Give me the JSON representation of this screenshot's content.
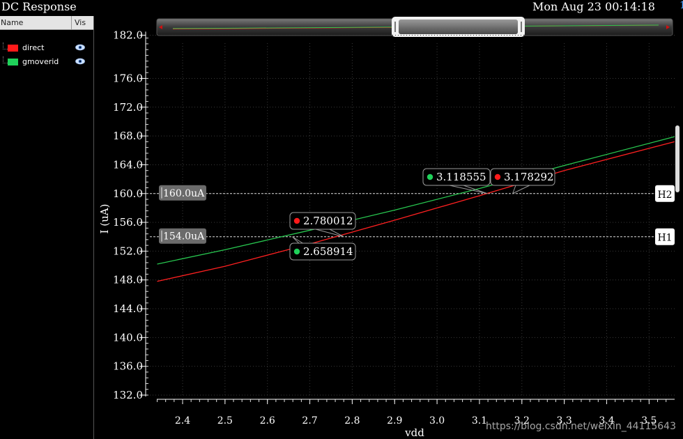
{
  "window": {
    "title": "DC Response",
    "datetime": "Mon Aug 23 00:14:18",
    "trunc_glyph": "1"
  },
  "legend": {
    "header_name": "Name",
    "header_vis": "Vis",
    "items": [
      {
        "label": "direct",
        "color": "#ff1a1a"
      },
      {
        "label": "gmoverid",
        "color": "#1fd15a"
      }
    ]
  },
  "chart_data": {
    "type": "line",
    "xlabel": "vdd",
    "ylabel": "I (uA)",
    "xlim": [
      2.34,
      3.56
    ],
    "ylim": [
      132.0,
      182.0
    ],
    "x_ticks": [
      "2.4",
      "2.5",
      "2.6",
      "2.7",
      "2.8",
      "2.9",
      "3.0",
      "3.1",
      "3.2",
      "3.3",
      "3.4",
      "3.5"
    ],
    "y_ticks": [
      "132.0",
      "136.0",
      "140.0",
      "144.0",
      "148.0",
      "152.0",
      "156.0",
      "160.0",
      "164.0",
      "168.0",
      "172.0",
      "176.0",
      "182.0"
    ],
    "grid": true,
    "series": [
      {
        "name": "direct",
        "color": "#ff2020",
        "x": [
          2.34,
          2.5,
          2.7,
          2.9,
          3.1,
          3.3,
          3.56
        ],
        "y": [
          147.8,
          149.9,
          153.0,
          156.3,
          159.7,
          163.2,
          167.2
        ]
      },
      {
        "name": "gmoverid",
        "color": "#28c850",
        "x": [
          2.34,
          2.5,
          2.7,
          2.9,
          3.1,
          3.3,
          3.56
        ],
        "y": [
          150.2,
          152.2,
          154.9,
          157.7,
          160.7,
          163.9,
          167.9
        ]
      }
    ],
    "h_markers": [
      {
        "label": "H1",
        "value": 154.0,
        "tag": "154.0uA"
      },
      {
        "label": "H2",
        "value": 160.0,
        "tag": "160.0uA"
      }
    ],
    "intercepts": [
      {
        "series": "direct",
        "x": 2.780012,
        "y": 154.0,
        "text": "2.780012",
        "color": "#ff1a1a"
      },
      {
        "series": "gmoverid",
        "x": 2.658914,
        "y": 154.0,
        "text": "2.658914",
        "color": "#1fd15a"
      },
      {
        "series": "gmoverid",
        "x": 3.118555,
        "y": 160.0,
        "text": "3.118555",
        "color": "#1fd15a"
      },
      {
        "series": "direct",
        "x": 3.178292,
        "y": 160.0,
        "text": "3.178292",
        "color": "#ff1a1a"
      }
    ]
  },
  "watermark": "https://blog.csdn.net/weixin_44115643"
}
